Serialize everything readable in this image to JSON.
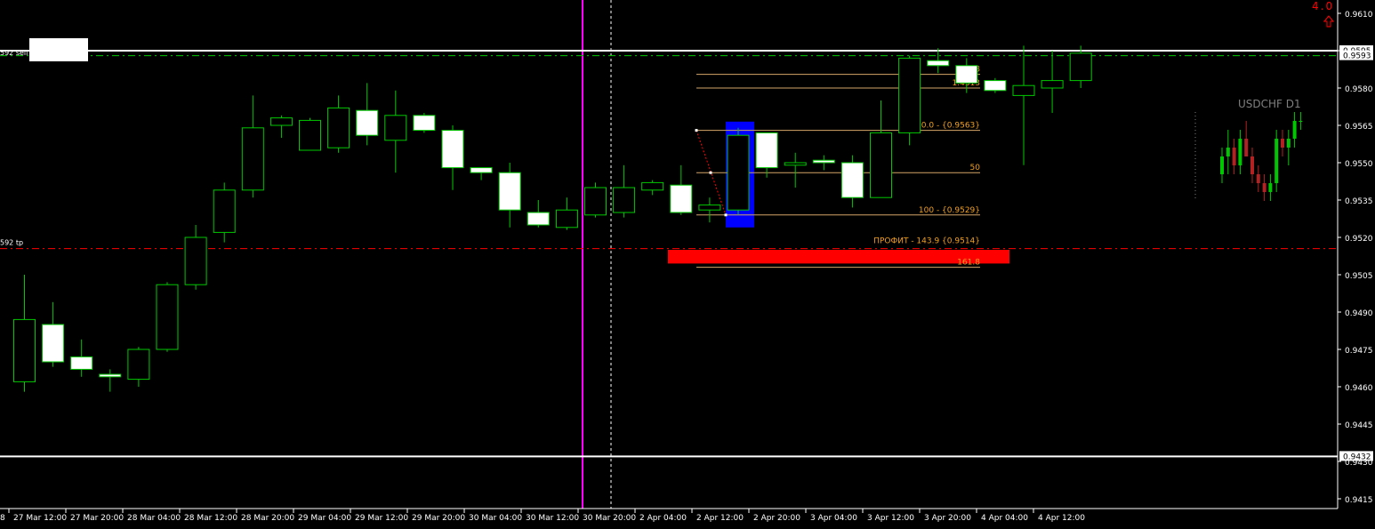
{
  "chart": {
    "symbol_label": "USDCHF D1",
    "corner_value": "4.0",
    "corner_icon": "arrow-up-icon",
    "colors": {
      "background": "#000000",
      "bull_body": "#000000",
      "bear_body": "#ffffff",
      "candle_outline": "#00c800",
      "axis_text": "#ffffff",
      "fib_line": "#d4a468",
      "fib_text": "#f0a020",
      "magenta_line": "#ff00ff",
      "profit_box": "#ff0000",
      "blue_box": "#0000ff",
      "sell_line": "#00c800",
      "tp_line": "#ff0000",
      "corner_text": "#ff0000",
      "mini_bull": "#00c800",
      "mini_bear": "#b22222"
    },
    "price_axis": {
      "ticks": [
        "0.9610",
        "0.9580",
        "0.9565",
        "0.9550",
        "0.9535",
        "0.9520",
        "0.9505",
        "0.9490",
        "0.9475",
        "0.9460",
        "0.9445",
        "0.9415"
      ],
      "hidden_ticks": [
        "0.9595",
        "0.9430"
      ],
      "highlight_tags": [
        {
          "value": "0.9595",
          "text": "0.9595"
        },
        {
          "value": "0.9593",
          "text": "0.9593"
        },
        {
          "value": "0.9432",
          "text": "0.9432"
        }
      ]
    },
    "time_axis": {
      "labels": [
        "27 Mar 12:00",
        "27 Mar 20:00",
        "28 Mar 04:00",
        "28 Mar 12:00",
        "28 Mar 20:00",
        "29 Mar 04:00",
        "29 Mar 12:00",
        "29 Mar 20:00",
        "30 Mar 04:00",
        "30 Mar 12:00",
        "30 Mar 20:00",
        "2 Apr 04:00",
        "2 Apr 12:00",
        "2 Apr 20:00",
        "3 Apr 04:00",
        "3 Apr 12:00",
        "3 Apr 20:00",
        "4 Apr 04:00",
        "4 Apr 12:00"
      ],
      "left_cut": "8"
    },
    "horizontal_lines": {
      "top_white": 0.9595,
      "bottom_white": 0.9432,
      "sell_level": 0.9593,
      "tp_level": 0.95155
    },
    "labels": {
      "sell": "592 sell",
      "tp": "592 tp"
    },
    "fib_levels": [
      {
        "value": 0.95855,
        "label": "1.618"
      },
      {
        "value": 0.958,
        "label": "1.4313"
      },
      {
        "value": 0.9563,
        "label": "0.0 - {0.9563}"
      },
      {
        "value": 0.9546,
        "label": "50"
      },
      {
        "value": 0.9529,
        "label": "100 - {0.9529}"
      },
      {
        "value": 0.9508,
        "label": "161.8"
      }
    ],
    "profit_label": "ПРОФИТ - 143.9 {0.9514}",
    "candles": [
      {
        "o": 0.9462,
        "h": 0.9505,
        "l": 0.9458,
        "c": 0.9487
      },
      {
        "o": 0.9485,
        "h": 0.9494,
        "l": 0.9468,
        "c": 0.947
      },
      {
        "o": 0.9472,
        "h": 0.9479,
        "l": 0.9464,
        "c": 0.9467
      },
      {
        "o": 0.9465,
        "h": 0.9467,
        "l": 0.9458,
        "c": 0.9464
      },
      {
        "o": 0.9463,
        "h": 0.9476,
        "l": 0.946,
        "c": 0.9475
      },
      {
        "o": 0.9475,
        "h": 0.9502,
        "l": 0.9474,
        "c": 0.9501
      },
      {
        "o": 0.9501,
        "h": 0.9525,
        "l": 0.9499,
        "c": 0.952
      },
      {
        "o": 0.9522,
        "h": 0.9542,
        "l": 0.9518,
        "c": 0.9539
      },
      {
        "o": 0.9539,
        "h": 0.9577,
        "l": 0.9536,
        "c": 0.9564
      },
      {
        "o": 0.9565,
        "h": 0.9569,
        "l": 0.956,
        "c": 0.9568
      },
      {
        "o": 0.9555,
        "h": 0.9568,
        "l": 0.9555,
        "c": 0.9567
      },
      {
        "o": 0.9556,
        "h": 0.9577,
        "l": 0.9554,
        "c": 0.9572
      },
      {
        "o": 0.9571,
        "h": 0.9582,
        "l": 0.9557,
        "c": 0.9561
      },
      {
        "o": 0.9559,
        "h": 0.9579,
        "l": 0.9546,
        "c": 0.9569
      },
      {
        "o": 0.9569,
        "h": 0.957,
        "l": 0.9562,
        "c": 0.9563
      },
      {
        "o": 0.9563,
        "h": 0.9565,
        "l": 0.9539,
        "c": 0.9548
      },
      {
        "o": 0.9548,
        "h": 0.9548,
        "l": 0.9543,
        "c": 0.9546
      },
      {
        "o": 0.9546,
        "h": 0.955,
        "l": 0.9524,
        "c": 0.9531
      },
      {
        "o": 0.953,
        "h": 0.9535,
        "l": 0.9524,
        "c": 0.9525
      },
      {
        "o": 0.9524,
        "h": 0.9536,
        "l": 0.9523,
        "c": 0.9531
      },
      {
        "o": 0.9529,
        "h": 0.9542,
        "l": 0.9528,
        "c": 0.954
      },
      {
        "o": 0.953,
        "h": 0.9549,
        "l": 0.9528,
        "c": 0.954
      },
      {
        "o": 0.9539,
        "h": 0.9543,
        "l": 0.9537,
        "c": 0.9542
      },
      {
        "o": 0.9541,
        "h": 0.9549,
        "l": 0.9529,
        "c": 0.953
      },
      {
        "o": 0.9531,
        "h": 0.9536,
        "l": 0.9526,
        "c": 0.9533
      },
      {
        "o": 0.9531,
        "h": 0.9564,
        "l": 0.9529,
        "c": 0.9561
      },
      {
        "o": 0.9562,
        "h": 0.9562,
        "l": 0.9544,
        "c": 0.9548
      },
      {
        "o": 0.9549,
        "h": 0.9554,
        "l": 0.954,
        "c": 0.955
      },
      {
        "o": 0.9551,
        "h": 0.9553,
        "l": 0.9547,
        "c": 0.955
      },
      {
        "o": 0.955,
        "h": 0.9553,
        "l": 0.9532,
        "c": 0.9536
      },
      {
        "o": 0.9536,
        "h": 0.9575,
        "l": 0.9536,
        "c": 0.9562
      },
      {
        "o": 0.9562,
        "h": 0.9593,
        "l": 0.9557,
        "c": 0.9592
      },
      {
        "o": 0.9591,
        "h": 0.9596,
        "l": 0.9586,
        "c": 0.9589
      },
      {
        "o": 0.9589,
        "h": 0.9592,
        "l": 0.9578,
        "c": 0.9582
      },
      {
        "o": 0.9583,
        "h": 0.9584,
        "l": 0.9578,
        "c": 0.9579
      },
      {
        "o": 0.9577,
        "h": 0.9597,
        "l": 0.9549,
        "c": 0.9581
      },
      {
        "o": 0.958,
        "h": 0.9595,
        "l": 0.957,
        "c": 0.9583
      },
      {
        "o": 0.9583,
        "h": 0.9597,
        "l": 0.958,
        "c": 0.9594
      }
    ],
    "mini_chart_candles": [
      {
        "o": 0.952,
        "h": 0.955,
        "l": 0.951,
        "c": 0.954
      },
      {
        "o": 0.954,
        "h": 0.957,
        "l": 0.952,
        "c": 0.955
      },
      {
        "o": 0.955,
        "h": 0.956,
        "l": 0.952,
        "c": 0.953
      },
      {
        "o": 0.953,
        "h": 0.957,
        "l": 0.952,
        "c": 0.956
      },
      {
        "o": 0.956,
        "h": 0.958,
        "l": 0.954,
        "c": 0.954
      },
      {
        "o": 0.954,
        "h": 0.955,
        "l": 0.951,
        "c": 0.952
      },
      {
        "o": 0.952,
        "h": 0.953,
        "l": 0.95,
        "c": 0.951
      },
      {
        "o": 0.951,
        "h": 0.952,
        "l": 0.949,
        "c": 0.95
      },
      {
        "o": 0.95,
        "h": 0.952,
        "l": 0.949,
        "c": 0.951
      },
      {
        "o": 0.951,
        "h": 0.957,
        "l": 0.95,
        "c": 0.956
      },
      {
        "o": 0.956,
        "h": 0.957,
        "l": 0.954,
        "c": 0.955
      },
      {
        "o": 0.955,
        "h": 0.957,
        "l": 0.953,
        "c": 0.956
      },
      {
        "o": 0.956,
        "h": 0.959,
        "l": 0.955,
        "c": 0.958
      },
      {
        "o": 0.958,
        "h": 0.959,
        "l": 0.957,
        "c": 0.958
      }
    ]
  }
}
